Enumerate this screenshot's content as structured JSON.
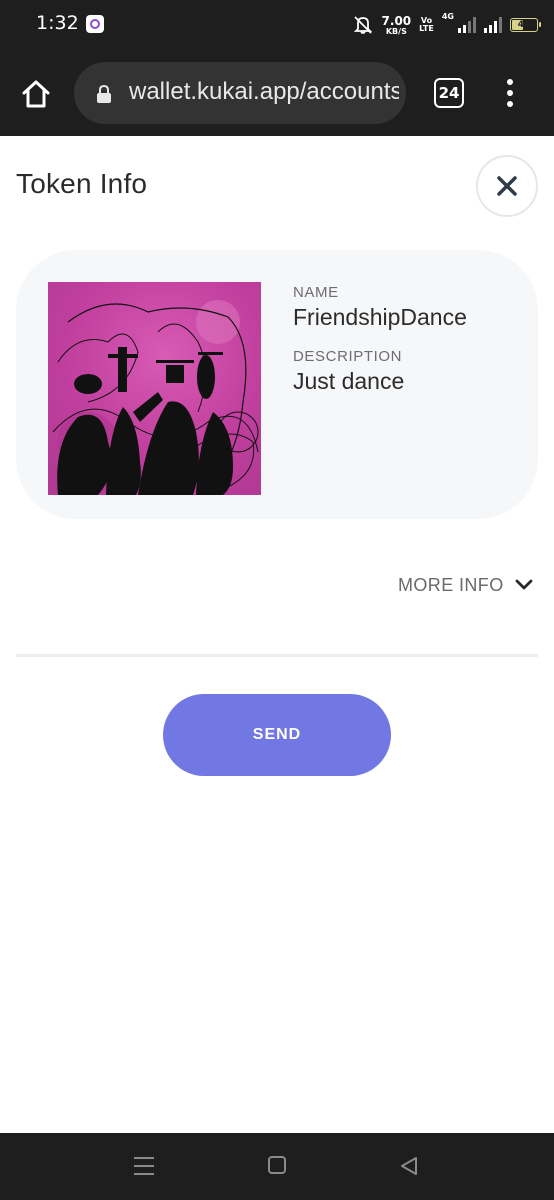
{
  "status_bar": {
    "time": "1:32",
    "net_speed_value": "7.00",
    "net_speed_unit": "KB/S",
    "volte_top": "Vo",
    "volte_bottom": "LTE",
    "network_type": "4G",
    "battery_level": "44",
    "battery_fraction": 0.44
  },
  "browser": {
    "url": "wallet.kukai.app/accounts",
    "tab_count": "24"
  },
  "page": {
    "title": "Token Info"
  },
  "token": {
    "name_label": "NAME",
    "name": "FriendshipDance",
    "description_label": "DESCRIPTION",
    "description": "Just dance"
  },
  "more_info_label": "MORE INFO",
  "send_label": "SEND",
  "colors": {
    "accent": "#7177e3",
    "card_bg": "#f6f7f9",
    "system_bar": "#1e1e1e"
  },
  "icons": {
    "home": "home-icon",
    "lock": "lock-icon",
    "menu": "more-vert-icon",
    "close": "close-icon",
    "chevron": "chevron-down-icon"
  }
}
